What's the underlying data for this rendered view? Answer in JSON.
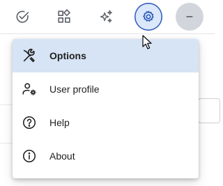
{
  "toolbar": {
    "buttons": [
      {
        "icon": "check-circle-icon"
      },
      {
        "icon": "apps-grid-icon"
      },
      {
        "icon": "sparkle-icon"
      },
      {
        "icon": "gear-icon",
        "state": "selected"
      },
      {
        "icon": "avatar"
      }
    ],
    "avatar_text": "–"
  },
  "menu": {
    "items": [
      {
        "label": "Options",
        "icon": "tools-icon",
        "active": true
      },
      {
        "label": "User profile",
        "icon": "user-settings-icon",
        "active": false
      },
      {
        "label": "Help",
        "icon": "help-circle-icon",
        "active": false
      },
      {
        "label": "About",
        "icon": "info-circle-icon",
        "active": false
      }
    ]
  },
  "colors": {
    "accent": "#2b59b9",
    "selected_button_bg": "#dbe7fb",
    "active_item_bg": "#d6e4f5",
    "avatar_bg": "#d2d6dc",
    "icon": "#5f6368"
  }
}
